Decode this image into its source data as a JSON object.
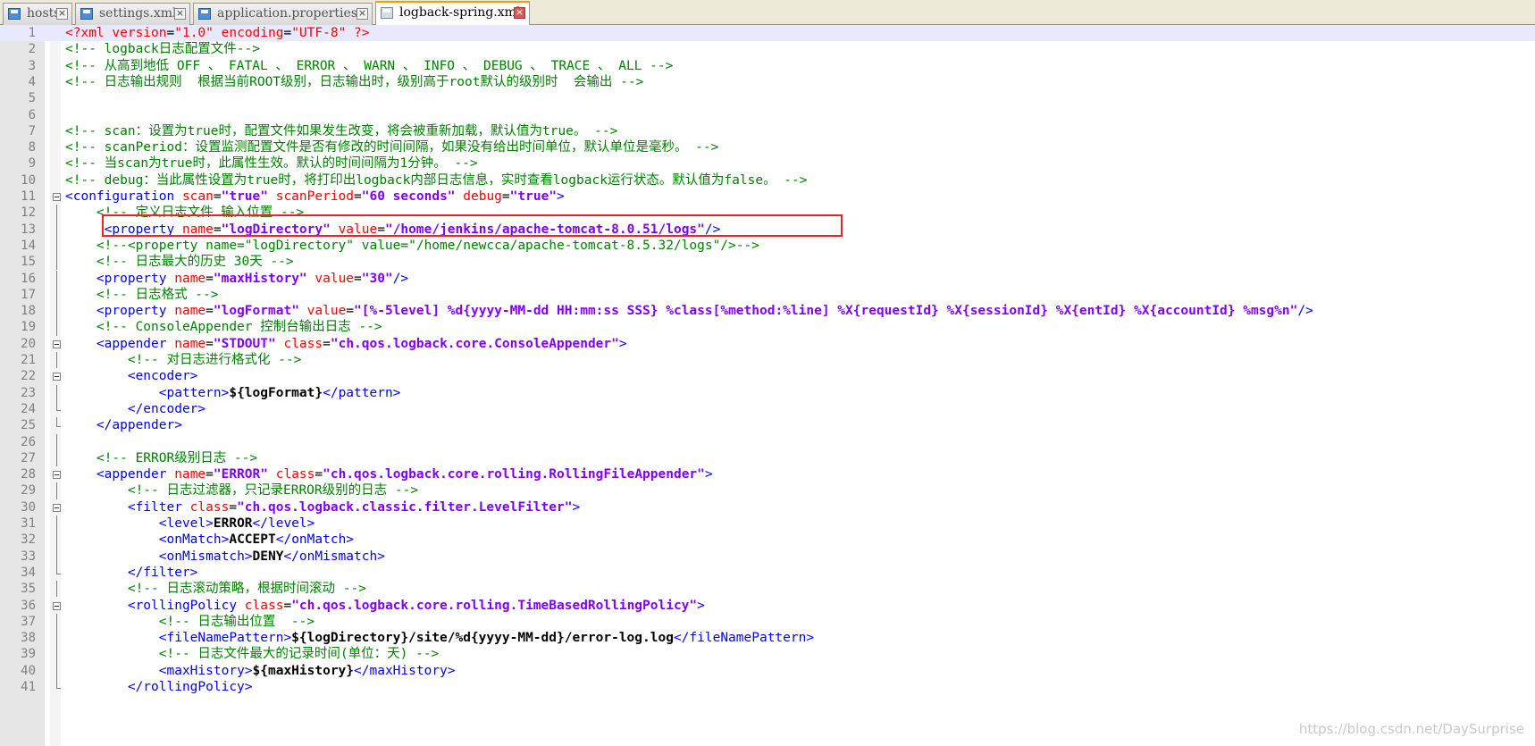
{
  "tabs": [
    {
      "label": "hosts",
      "active": false
    },
    {
      "label": "settings.xml",
      "active": false
    },
    {
      "label": "application.properties",
      "active": false
    },
    {
      "label": "logback-spring.xml",
      "active": true
    }
  ],
  "editor": {
    "current_line": 1,
    "highlighted_line": 13,
    "lines": [
      {
        "n": "1",
        "tokens": [
          [
            "pi",
            "<?xml "
          ],
          [
            "attr",
            "version"
          ],
          [
            "eq",
            "="
          ],
          [
            "pi",
            "\"1.0\" "
          ],
          [
            "attr",
            "encoding"
          ],
          [
            "eq",
            "="
          ],
          [
            "pi",
            "\"UTF-8\" ?>"
          ]
        ]
      },
      {
        "n": "2",
        "tokens": [
          [
            "cm",
            "<!-- logback日志配置文件-->"
          ]
        ]
      },
      {
        "n": "3",
        "tokens": [
          [
            "cm",
            "<!-- 从高到地低 OFF 、 FATAL 、 ERROR 、 WARN 、 INFO 、 DEBUG 、 TRACE 、 ALL -->"
          ]
        ]
      },
      {
        "n": "4",
        "tokens": [
          [
            "cm",
            "<!-- 日志输出规则  根据当前ROOT级别，日志输出时，级别高于root默认的级别时  会输出 -->"
          ]
        ]
      },
      {
        "n": "5",
        "tokens": []
      },
      {
        "n": "6",
        "tokens": []
      },
      {
        "n": "7",
        "tokens": [
          [
            "cm",
            "<!-- scan：设置为true时，配置文件如果发生改变，将会被重新加载，默认值为true。 -->"
          ]
        ]
      },
      {
        "n": "8",
        "tokens": [
          [
            "cm",
            "<!-- scanPeriod：设置监测配置文件是否有修改的时间间隔，如果没有给出时间单位，默认单位是毫秒。 -->"
          ]
        ]
      },
      {
        "n": "9",
        "tokens": [
          [
            "cm",
            "<!-- 当scan为true时，此属性生效。默认的时间间隔为1分钟。 -->"
          ]
        ]
      },
      {
        "n": "10",
        "tokens": [
          [
            "cm",
            "<!-- debug：当此属性设置为true时，将打印出logback内部日志信息，实时查看logback运行状态。默认值为false。 -->"
          ]
        ]
      },
      {
        "n": "11",
        "fold": "open",
        "tokens": [
          [
            "tag",
            "<configuration "
          ],
          [
            "attr",
            "scan"
          ],
          [
            "eq",
            "="
          ],
          [
            "val",
            "\"true\" "
          ],
          [
            "attr",
            "scanPeriod"
          ],
          [
            "eq",
            "="
          ],
          [
            "val",
            "\"60 seconds\" "
          ],
          [
            "attr",
            "debug"
          ],
          [
            "eq",
            "="
          ],
          [
            "val",
            "\"true\""
          ],
          [
            "tag",
            ">"
          ]
        ]
      },
      {
        "n": "12",
        "fold": "line",
        "tokens": [
          [
            "ws",
            "    "
          ],
          [
            "cm",
            "<!-- 定义日志文件 输入位置 -->"
          ]
        ]
      },
      {
        "n": "13",
        "fold": "line",
        "tokens": [
          [
            "ws",
            "     "
          ],
          [
            "tag",
            "<property "
          ],
          [
            "attr",
            "name"
          ],
          [
            "eq",
            "="
          ],
          [
            "val",
            "\"logDirectory\" "
          ],
          [
            "attr",
            "value"
          ],
          [
            "eq",
            "="
          ],
          [
            "val",
            "\"/home/jenkins/apache-tomcat-8.0.51/logs\""
          ],
          [
            "tag",
            "/>"
          ]
        ]
      },
      {
        "n": "14",
        "fold": "line",
        "tokens": [
          [
            "ws",
            "    "
          ],
          [
            "cm",
            "<!--<property name=\"logDirectory\" value=\"/home/newcca/apache-tomcat-8.5.32/logs\"/>-->"
          ]
        ]
      },
      {
        "n": "15",
        "fold": "line",
        "tokens": [
          [
            "ws",
            "    "
          ],
          [
            "cm",
            "<!-- 日志最大的历史 30天 -->"
          ]
        ]
      },
      {
        "n": "16",
        "fold": "line",
        "tokens": [
          [
            "ws",
            "    "
          ],
          [
            "tag",
            "<property "
          ],
          [
            "attr",
            "name"
          ],
          [
            "eq",
            "="
          ],
          [
            "val",
            "\"maxHistory\" "
          ],
          [
            "attr",
            "value"
          ],
          [
            "eq",
            "="
          ],
          [
            "val",
            "\"30\""
          ],
          [
            "tag",
            "/>"
          ]
        ]
      },
      {
        "n": "17",
        "fold": "line",
        "tokens": [
          [
            "ws",
            "    "
          ],
          [
            "cm",
            "<!-- 日志格式 -->"
          ]
        ]
      },
      {
        "n": "18",
        "fold": "line",
        "tokens": [
          [
            "ws",
            "    "
          ],
          [
            "tag",
            "<property "
          ],
          [
            "attr",
            "name"
          ],
          [
            "eq",
            "="
          ],
          [
            "val",
            "\"logFormat\" "
          ],
          [
            "attr",
            "value"
          ],
          [
            "eq",
            "="
          ],
          [
            "val",
            "\"[%-5level] %d{yyyy-MM-dd HH:mm:ss SSS} %class[%method:%line] %X{requestId} %X{sessionId} %X{entId} %X{accountId} %msg%n\""
          ],
          [
            "tag",
            "/>"
          ]
        ]
      },
      {
        "n": "19",
        "fold": "line",
        "tokens": [
          [
            "ws",
            "    "
          ],
          [
            "cm",
            "<!-- ConsoleAppender 控制台输出日志 -->"
          ]
        ]
      },
      {
        "n": "20",
        "fold": "open",
        "tokens": [
          [
            "ws",
            "    "
          ],
          [
            "tag",
            "<appender "
          ],
          [
            "attr",
            "name"
          ],
          [
            "eq",
            "="
          ],
          [
            "val",
            "\"STDOUT\" "
          ],
          [
            "attr",
            "class"
          ],
          [
            "eq",
            "="
          ],
          [
            "val",
            "\"ch.qos.logback.core.ConsoleAppender\""
          ],
          [
            "tag",
            ">"
          ]
        ]
      },
      {
        "n": "21",
        "fold": "line",
        "tokens": [
          [
            "ws",
            "        "
          ],
          [
            "cm",
            "<!-- 对日志进行格式化 -->"
          ]
        ]
      },
      {
        "n": "22",
        "fold": "open",
        "tokens": [
          [
            "ws",
            "        "
          ],
          [
            "tag",
            "<encoder>"
          ]
        ]
      },
      {
        "n": "23",
        "fold": "line",
        "tokens": [
          [
            "ws",
            "            "
          ],
          [
            "tag",
            "<pattern>"
          ],
          [
            "txt",
            "${logFormat}"
          ],
          [
            "tag",
            "</pattern>"
          ]
        ]
      },
      {
        "n": "24",
        "fold": "end",
        "tokens": [
          [
            "ws",
            "        "
          ],
          [
            "tag",
            "</encoder>"
          ]
        ]
      },
      {
        "n": "25",
        "fold": "end",
        "tokens": [
          [
            "ws",
            "    "
          ],
          [
            "tag",
            "</appender>"
          ]
        ]
      },
      {
        "n": "26",
        "fold": "line",
        "tokens": []
      },
      {
        "n": "27",
        "fold": "line",
        "tokens": [
          [
            "ws",
            "    "
          ],
          [
            "cm",
            "<!-- ERROR级别日志 -->"
          ]
        ]
      },
      {
        "n": "28",
        "fold": "open",
        "tokens": [
          [
            "ws",
            "    "
          ],
          [
            "tag",
            "<appender "
          ],
          [
            "attr",
            "name"
          ],
          [
            "eq",
            "="
          ],
          [
            "val",
            "\"ERROR\" "
          ],
          [
            "attr",
            "class"
          ],
          [
            "eq",
            "="
          ],
          [
            "val",
            "\"ch.qos.logback.core.rolling.RollingFileAppender\""
          ],
          [
            "tag",
            ">"
          ]
        ]
      },
      {
        "n": "29",
        "fold": "line",
        "tokens": [
          [
            "ws",
            "        "
          ],
          [
            "cm",
            "<!-- 日志过滤器，只记录ERROR级别的日志 -->"
          ]
        ]
      },
      {
        "n": "30",
        "fold": "open",
        "tokens": [
          [
            "ws",
            "        "
          ],
          [
            "tag",
            "<filter "
          ],
          [
            "attr",
            "class"
          ],
          [
            "eq",
            "="
          ],
          [
            "val",
            "\"ch.qos.logback.classic.filter.LevelFilter\""
          ],
          [
            "tag",
            ">"
          ]
        ]
      },
      {
        "n": "31",
        "fold": "line",
        "tokens": [
          [
            "ws",
            "            "
          ],
          [
            "tag",
            "<level>"
          ],
          [
            "txt",
            "ERROR"
          ],
          [
            "tag",
            "</level>"
          ]
        ]
      },
      {
        "n": "32",
        "fold": "line",
        "tokens": [
          [
            "ws",
            "            "
          ],
          [
            "tag",
            "<onMatch>"
          ],
          [
            "txt",
            "ACCEPT"
          ],
          [
            "tag",
            "</onMatch>"
          ]
        ]
      },
      {
        "n": "33",
        "fold": "line",
        "tokens": [
          [
            "ws",
            "            "
          ],
          [
            "tag",
            "<onMismatch>"
          ],
          [
            "txt",
            "DENY"
          ],
          [
            "tag",
            "</onMismatch>"
          ]
        ]
      },
      {
        "n": "34",
        "fold": "end",
        "tokens": [
          [
            "ws",
            "        "
          ],
          [
            "tag",
            "</filter>"
          ]
        ]
      },
      {
        "n": "35",
        "fold": "line",
        "tokens": [
          [
            "ws",
            "        "
          ],
          [
            "cm",
            "<!-- 日志滚动策略，根据时间滚动 -->"
          ]
        ]
      },
      {
        "n": "36",
        "fold": "open",
        "tokens": [
          [
            "ws",
            "        "
          ],
          [
            "tag",
            "<rollingPolicy "
          ],
          [
            "attr",
            "class"
          ],
          [
            "eq",
            "="
          ],
          [
            "val",
            "\"ch.qos.logback.core.rolling.TimeBasedRollingPolicy\""
          ],
          [
            "tag",
            ">"
          ]
        ]
      },
      {
        "n": "37",
        "fold": "line",
        "tokens": [
          [
            "ws",
            "            "
          ],
          [
            "cm",
            "<!-- 日志输出位置  -->"
          ]
        ]
      },
      {
        "n": "38",
        "fold": "line",
        "tokens": [
          [
            "ws",
            "            "
          ],
          [
            "tag",
            "<fileNamePattern>"
          ],
          [
            "txt",
            "${logDirectory}/site/%d{yyyy-MM-dd}/error-log.log"
          ],
          [
            "tag",
            "</fileNamePattern>"
          ]
        ]
      },
      {
        "n": "39",
        "fold": "line",
        "tokens": [
          [
            "ws",
            "            "
          ],
          [
            "cm",
            "<!-- 日志文件最大的记录时间(单位：天) -->"
          ]
        ]
      },
      {
        "n": "40",
        "fold": "line",
        "tokens": [
          [
            "ws",
            "            "
          ],
          [
            "tag",
            "<maxHistory>"
          ],
          [
            "txt",
            "${maxHistory}"
          ],
          [
            "tag",
            "</maxHistory>"
          ]
        ]
      },
      {
        "n": "41",
        "fold": "end",
        "tokens": [
          [
            "ws",
            "        "
          ],
          [
            "tag",
            "</rollingPolicy>"
          ]
        ]
      }
    ]
  },
  "watermark": "https://blog.csdn.net/DaySurprise",
  "colors": {
    "comment": "#008000",
    "tag": "#0000ff",
    "attribute": "#ff0000",
    "value": "#8000ff",
    "highlight_box": "#e8252a",
    "current_line": "#e8e8ff"
  },
  "icons": {
    "tab_file": "file-save-icon",
    "tab_close": "close-icon",
    "fold_open": "fold-minus-icon"
  }
}
